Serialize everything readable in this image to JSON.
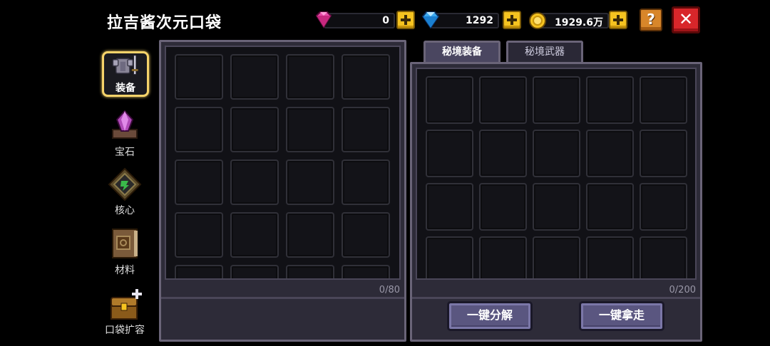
{
  "title": "拉吉酱次元口袋",
  "currencies": {
    "gems": {
      "value": "0",
      "icon": "pink-gem-icon",
      "color": "#e84aa8"
    },
    "diamonds": {
      "value": "1292",
      "icon": "blue-diamond-icon",
      "color": "#3aa8f0"
    },
    "gold": {
      "value": "1929.6万",
      "icon": "gold-coin-icon",
      "color": "#f5c320"
    }
  },
  "help_label": "?",
  "close_label": "✕",
  "sidebar": {
    "items": [
      {
        "label": "装备",
        "icon": "armor-icon",
        "active": true
      },
      {
        "label": "宝石",
        "icon": "gem-stone-icon",
        "active": false
      },
      {
        "label": "核心",
        "icon": "core-icon",
        "active": false
      },
      {
        "label": "材料",
        "icon": "material-book-icon",
        "active": false
      },
      {
        "label": "口袋扩容",
        "icon": "treasure-chest-icon",
        "active": false
      }
    ]
  },
  "left_panel": {
    "count": "0/80"
  },
  "right_panel": {
    "tabs": [
      {
        "label": "秘境装备",
        "active": true
      },
      {
        "label": "秘境武器",
        "active": false
      }
    ],
    "count": "0/200",
    "buttons": {
      "disassemble": "一键分解",
      "take_all": "一键拿走"
    }
  }
}
